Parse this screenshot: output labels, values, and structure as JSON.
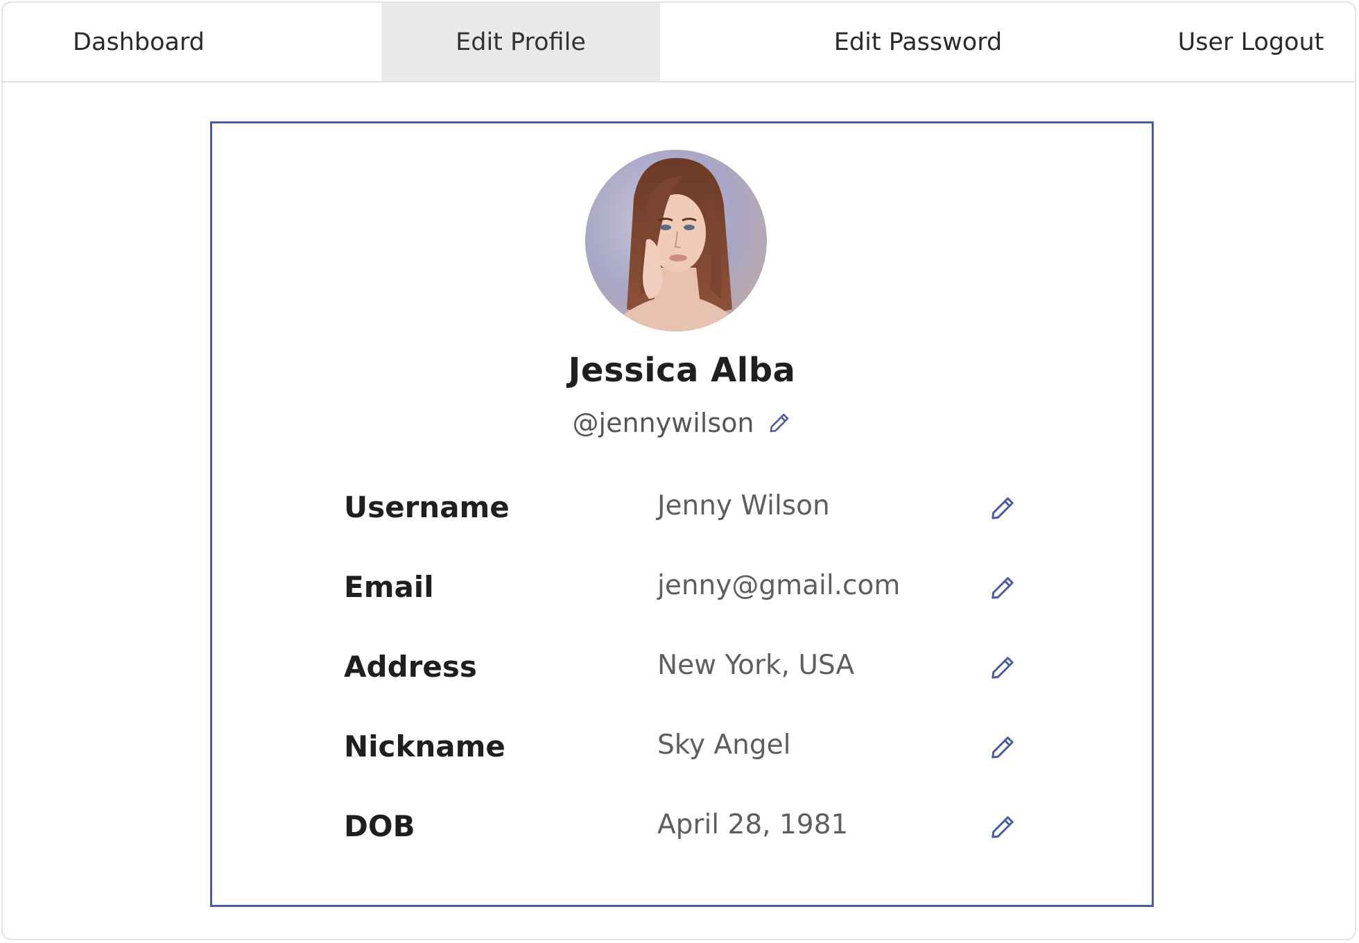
{
  "nav": {
    "tabs": [
      {
        "label": "Dashboard",
        "active": false
      },
      {
        "label": "Edit Profile",
        "active": true
      },
      {
        "label": "Edit Password",
        "active": false
      },
      {
        "label": "User Logout",
        "active": false
      }
    ]
  },
  "profile": {
    "full_name": "Jessica Alba",
    "handle": "@jennywilson",
    "avatar_icon": "profile-photo",
    "fields": [
      {
        "label": "Username",
        "value": "Jenny Wilson"
      },
      {
        "label": "Email",
        "value": "jenny@gmail.com"
      },
      {
        "label": "Address",
        "value": "New York, USA"
      },
      {
        "label": "Nickname",
        "value": "Sky Angel"
      },
      {
        "label": "DOB",
        "value": "April 28, 1981"
      }
    ]
  },
  "icons": {
    "edit": "pencil-icon"
  },
  "colors": {
    "accent": "#4a5ba6",
    "active_tab_bg": "#e9e9e9",
    "label_text": "#1f1f1f",
    "value_text": "#5e5e5e"
  }
}
